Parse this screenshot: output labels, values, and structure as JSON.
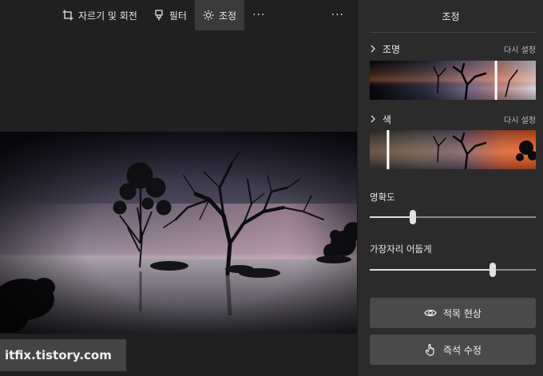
{
  "toolbar": {
    "crop_label": "자르기 및 회전",
    "filter_label": "필터",
    "adjust_label": "조정",
    "more1": "···",
    "more2": "···"
  },
  "panel": {
    "title": "조정",
    "light": {
      "label": "조명",
      "reset": "다시 설정",
      "value": 0.76
    },
    "color": {
      "label": "색",
      "reset": "다시 설정",
      "value": 0.11
    },
    "clarity": {
      "label": "명확도",
      "value": 0.26
    },
    "vignette": {
      "label": "가장자리 어둡게",
      "value": 0.74
    },
    "redeye_label": "적목 현상",
    "spotfix_label": "즉석 수정"
  },
  "watermark": "itfix.tistory.com"
}
